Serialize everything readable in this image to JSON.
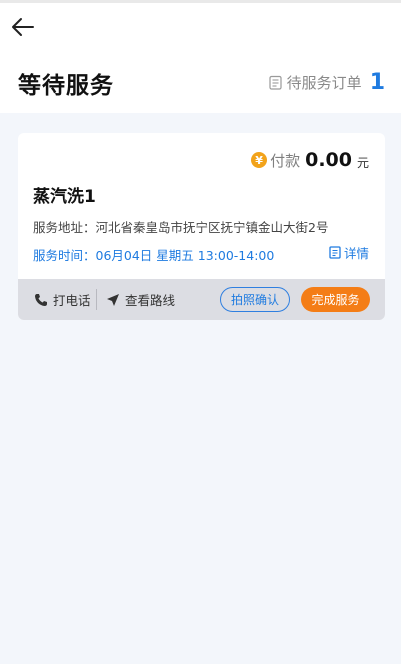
{
  "header": {
    "title": "等待服务",
    "back_icon": "arrow-left-icon",
    "pending_label": "待服务订单",
    "pending_count": "1",
    "pending_icon": "clipboard-icon"
  },
  "order": {
    "pay_icon": "yen-coin-icon",
    "pay_icon_glyph": "¥",
    "pay_label": "付款",
    "pay_amount": "0.00",
    "pay_unit": "元",
    "service_name": "蒸汽洗1",
    "address": "服务地址：河北省秦皇岛市抚宁区抚宁镇金山大街2号",
    "time": "服务时间：06月04日 星期五 13:00-14:00",
    "detail_label": "详情",
    "detail_icon": "document-icon"
  },
  "actions": {
    "call_label": "打电话",
    "call_icon": "phone-icon",
    "route_label": "查看路线",
    "route_icon": "navigation-arrow-icon",
    "photo_confirm_label": "拍照确认",
    "complete_label": "完成服务"
  },
  "colors": {
    "accent_blue": "#1f7be0",
    "accent_orange": "#f47d16",
    "coin": "#f2a31b",
    "background": "#f3f6fb",
    "action_bar": "#dcdde3"
  }
}
